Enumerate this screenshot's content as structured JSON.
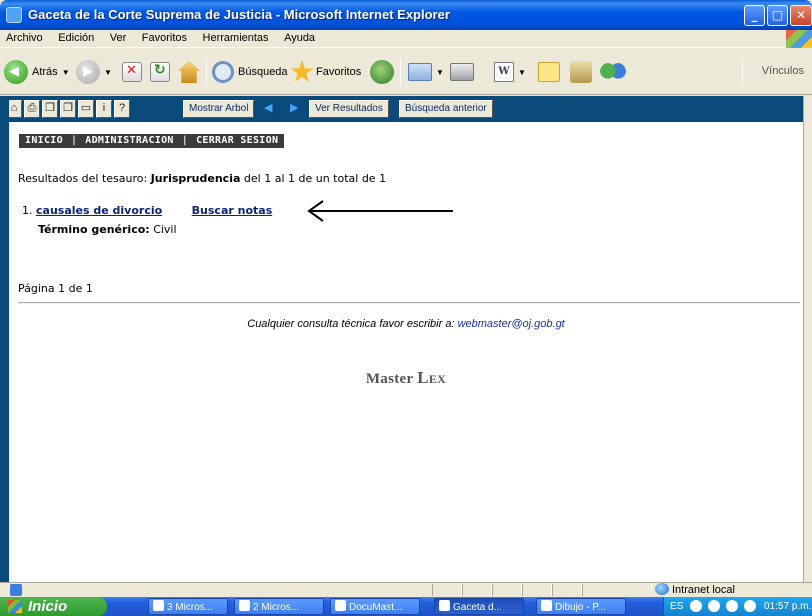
{
  "window": {
    "title": "Gaceta de la Corte Suprema de Justicia - Microsoft Internet Explorer",
    "controls": {
      "minimize": "_",
      "maximize": "□",
      "close": "✕"
    }
  },
  "menubar": [
    "Archivo",
    "Edición",
    "Ver",
    "Favoritos",
    "Herramientas",
    "Ayuda"
  ],
  "toolbar": {
    "back_label": "Atrás",
    "search_label": "Búsqueda",
    "favorites_label": "Favoritos",
    "word_glyph": "W",
    "links_label": "Vínculos"
  },
  "appbar": {
    "show_tree": "Mostrar Arbol",
    "view_results": "Ver Resultados",
    "previous_search": "Búsqueda anterior",
    "icon_glyphs": [
      "⌂",
      "⎙",
      "❐",
      "❐",
      "▭",
      "i",
      "?"
    ],
    "nav_left": "◀",
    "nav_right": "▶"
  },
  "navbar": {
    "home": "INICIO",
    "admin": "ADMINISTRACION",
    "logout": "CERRAR SESION",
    "separator": "|"
  },
  "results": {
    "prefix": "Resultados del tesauro:",
    "thesaurus": "Jurisprudencia",
    "suffix": "del 1 al 1 de un total de 1",
    "items": [
      {
        "number": "1.",
        "title": "causales de divorcio",
        "notes_link": "Buscar notas",
        "generic_label": "Término genérico:",
        "generic_value": "Civil"
      }
    ],
    "pagination": "Página 1 de 1"
  },
  "footer": {
    "contact_text": "Cualquier consulta técnica favor escribir a:",
    "email": "webmaster@oj.gob.gt",
    "brand_master": "Master",
    "brand_lex": "Lex"
  },
  "statusbar": {
    "zone": "Intranet local"
  },
  "taskbar": {
    "start": "Inicio",
    "tasks": [
      "3 Micros...",
      "2 Micros...",
      "DocuMast...",
      "Gaceta d...",
      "Dibujo - P..."
    ],
    "active_task": "Gaceta d...",
    "language": "ES",
    "clock": "01:57 p.m."
  },
  "colors": {
    "titlebar": "#0058e6",
    "appbar": "#0a4a7a",
    "link": "#0a247a",
    "navbar": "#3b3b3b"
  }
}
